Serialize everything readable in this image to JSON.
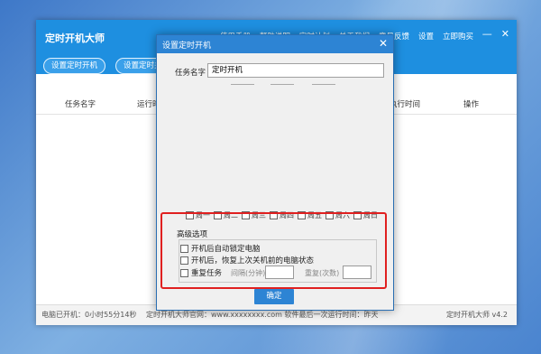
{
  "app": {
    "title": "定时开机大师",
    "menu": [
      "使用手册",
      "帮助说明",
      "定时计划",
      "关于我们",
      "意见反馈",
      "设置",
      "立即购买"
    ],
    "toolbar": [
      "设置定时开机",
      "设置定时关"
    ],
    "columns": [
      "任务名字",
      "运行时",
      "执行时间",
      "操作"
    ],
    "status_uptime": "电脑已开机：0小时55分14秒",
    "status_center": "定时开机大师官网：www.xxxxxxxx.com  软件最后一次运行时间：昨天",
    "status_version": "定时开机大师 v4.2"
  },
  "dialog": {
    "title": "设置定时开机",
    "task_name_label": "任务名字",
    "task_name_value": "定时开机",
    "weekdays": [
      "周一",
      "周二",
      "周三",
      "周四",
      "周五",
      "周六",
      "周日"
    ],
    "advanced_legend": "高级选项",
    "opt_lock": "开机后自动锁定电脑",
    "opt_restore": "开机后，恢复上次关机前的电脑状态",
    "opt_repeat": "重复任务",
    "interval_label": "间隔(分钟)",
    "repeat_label": "重复(次数)",
    "ok_button": "确定"
  },
  "colors": {
    "titlebar": "#1e8fe0",
    "dialog_titlebar": "#2d84d4",
    "highlight": "#e02020"
  }
}
